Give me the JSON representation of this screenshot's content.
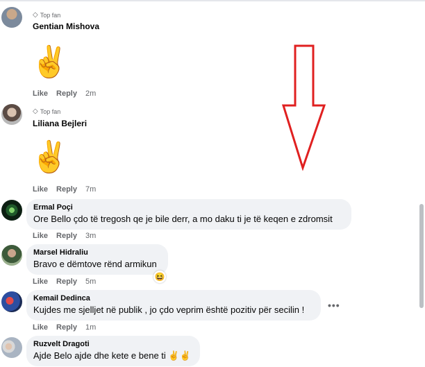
{
  "labels": {
    "top_fan": "Top fan",
    "like": "Like",
    "reply": "Reply"
  },
  "comments": [
    {
      "name": "Gentian Mishova",
      "top_fan": true,
      "emoji": "✌️",
      "time": "2m"
    },
    {
      "name": "Liliana Bejleri",
      "top_fan": true,
      "emoji": "✌️",
      "time": "7m"
    },
    {
      "name": "Ermal Poçi",
      "text": "Ore Bello çdo të tregosh qe je bile derr, a mo daku ti je të keqen e zdromsit",
      "time": "3m"
    },
    {
      "name": "Marsel Hidraliu",
      "text": "Bravo e dëmtove rënd armikun",
      "reaction": "😆",
      "time": "5m"
    },
    {
      "name": "Kemail Dedinca",
      "text": "Kujdes me sjelljet në publik , jo çdo veprim është pozitiv për secilin !",
      "more": "•••",
      "time": "1m"
    },
    {
      "name": "Ruzvelt Dragoti",
      "text": "Ajde Belo ajde dhe kete e bene ti ✌️✌️"
    }
  ],
  "annotation": {
    "color": "#e02020",
    "direction": "down"
  },
  "colors": {
    "bubble": "#f0f2f5",
    "meta": "#65676b",
    "text": "#050505"
  }
}
